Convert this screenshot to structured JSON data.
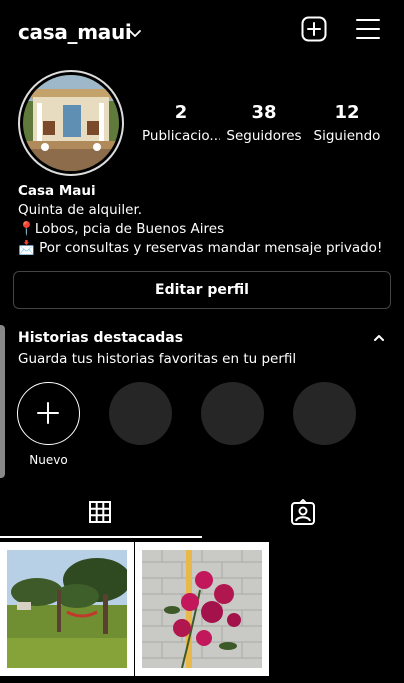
{
  "header": {
    "username": "casa_maui",
    "icons": {
      "dropdown": "chevron-down-icon",
      "add": "plus-square-icon",
      "menu": "hamburger-menu-icon"
    }
  },
  "profile": {
    "avatar_icon": "profile-photo",
    "stats": [
      {
        "value": "2",
        "label": "Publicacio..."
      },
      {
        "value": "38",
        "label": "Seguidores"
      },
      {
        "value": "12",
        "label": "Siguiendo"
      }
    ],
    "bio": {
      "name": "Casa Maui",
      "line1": "Quinta de alquiler.",
      "line2_icon": "📍",
      "line2": "Lobos, pcia de Buenos Aires",
      "line3_icon": "📩",
      "line3": "Por consultas y reservas mandar mensaje privado!"
    },
    "edit_button": "Editar perfil"
  },
  "highlights": {
    "title": "Historias destacadas",
    "subtitle": "Guarda tus historias favoritas en tu perfil",
    "new_label": "Nuevo"
  },
  "tabs": {
    "grid_icon": "grid-icon",
    "tagged_icon": "tagged-person-icon"
  },
  "colors": {
    "background": "#000000",
    "text": "#ffffff",
    "placeholder": "#262626",
    "border": "#444444"
  }
}
